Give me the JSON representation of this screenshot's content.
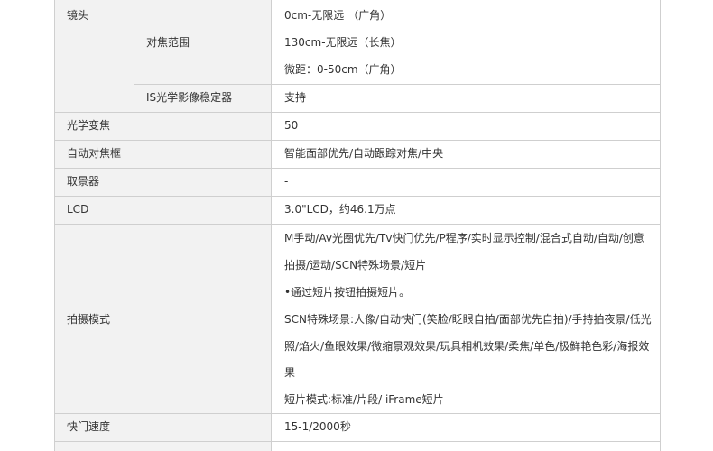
{
  "rows": {
    "lens": {
      "label": "镜头",
      "focus_range": {
        "label": "对焦范围",
        "values": [
          "0cm-无限远 （广角）",
          "130cm-无限远（长焦）",
          "微距：0-50cm（广角）"
        ]
      },
      "stabilizer": {
        "label": "IS光学影像稳定器",
        "value": "支持"
      }
    },
    "optical_zoom": {
      "label": "光学变焦",
      "value": "50"
    },
    "af_frame": {
      "label": "自动对焦框",
      "value": "智能面部优先/自动跟踪对焦/中央"
    },
    "viewfinder": {
      "label": "取景器",
      "value": "-"
    },
    "lcd": {
      "label": "LCD",
      "value": "3.0\"LCD，约46.1万点"
    },
    "shooting_modes": {
      "label": "拍摄模式",
      "lines": [
        "M手动/Av光圈优先/Tv快门优先/P程序/实时显示控制/混合式自动/自动/创意",
        "拍摄/运动/SCN特殊场景/短片",
        "•通过短片按钮拍摄短片。",
        "SCN特殊场景:人像/自动快门(笑脸/眨眼自拍/面部优先自拍)/手持拍夜景/低光",
        "照/焰火/鱼眼效果/微缩景观效果/玩具相机效果/柔焦/单色/极鲜艳色彩/海报效",
        "果",
        "短片模式:标准/片段/ iFrame短片"
      ]
    },
    "shutter_speed": {
      "label": "快门速度",
      "value": "15-1/2000秒"
    }
  }
}
